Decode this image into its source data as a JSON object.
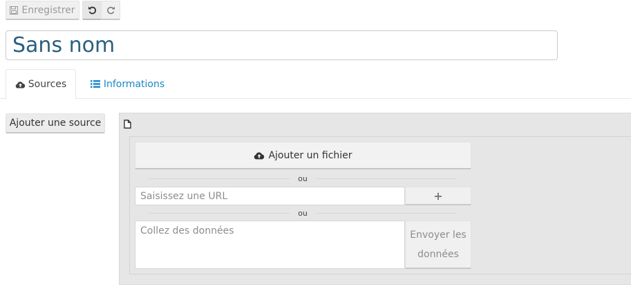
{
  "toolbar": {
    "save_label": "Enregistrer",
    "save_icon": "floppy-disk-icon",
    "undo_icon": "undo-icon",
    "redo_icon": "redo-icon"
  },
  "document": {
    "title": "Sans nom"
  },
  "tabs": [
    {
      "label": "Sources",
      "icon": "cloud-upload-icon",
      "active": true
    },
    {
      "label": "Informations",
      "icon": "list-icon",
      "active": false
    }
  ],
  "sidebar": {
    "add_source_label": "Ajouter une source"
  },
  "source_panel": {
    "file_icon": "file-icon",
    "add_file_label": "Ajouter un fichier",
    "separator_1": "ou",
    "separator_2": "ou",
    "url_placeholder": "Saisissez une URL",
    "url_add_symbol": "+",
    "paste_placeholder": "Collez des données",
    "send_label_line1": "Envoyer les",
    "send_label_line2": "données"
  },
  "colors": {
    "title_text": "#2c5f7f",
    "link_blue": "#1a87c7",
    "panel_bg": "#e6e6e6"
  }
}
